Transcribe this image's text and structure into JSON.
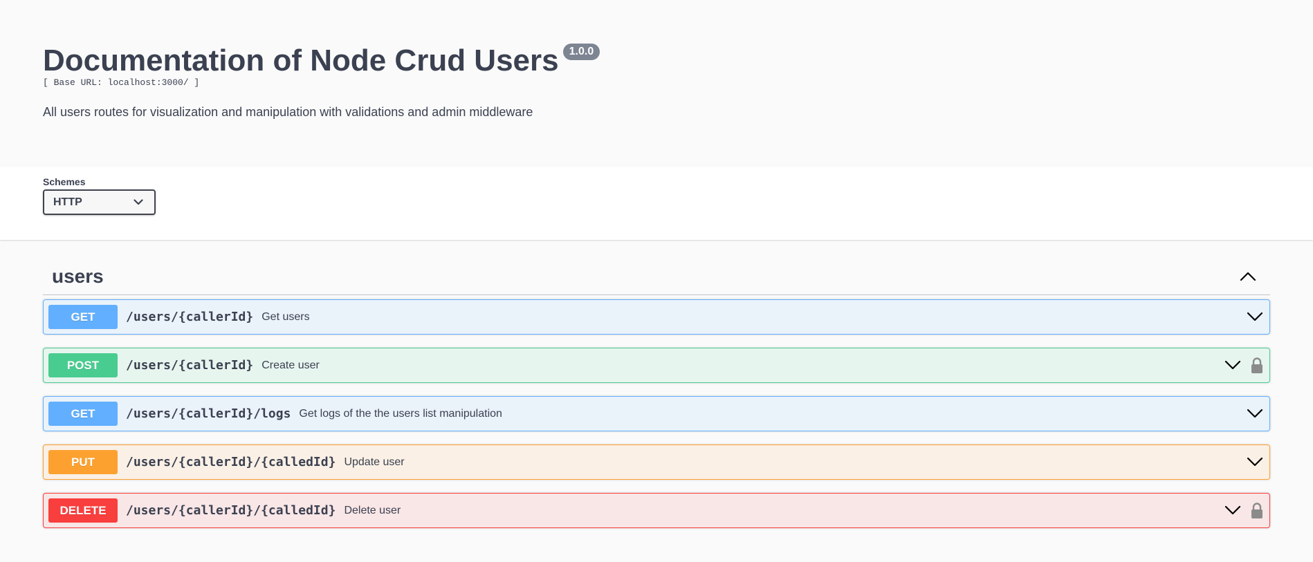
{
  "info": {
    "title": "Documentation of Node Crud Users",
    "version": "1.0.0",
    "base_url": "[ Base URL: localhost:3000/ ]",
    "description": "All users routes for visualization and manipulation with validations and admin middleware"
  },
  "schemes": {
    "label": "Schemes",
    "selected": "HTTP",
    "icon": "chevron-down-icon"
  },
  "tag": {
    "name": "users",
    "icon": "chevron-up-icon"
  },
  "operations": [
    {
      "method": "GET",
      "path": "/users/{callerId}",
      "summary": "Get users",
      "locked": false
    },
    {
      "method": "POST",
      "path": "/users/{callerId}",
      "summary": "Create user",
      "locked": true
    },
    {
      "method": "GET",
      "path": "/users/{callerId}/logs",
      "summary": "Get logs of the the users list manipulation",
      "locked": false
    },
    {
      "method": "PUT",
      "path": "/users/{callerId}/{calledId}",
      "summary": "Update user",
      "locked": false
    },
    {
      "method": "DELETE",
      "path": "/users/{callerId}/{calledId}",
      "summary": "Delete user",
      "locked": true
    }
  ],
  "colors": {
    "get": "#61affe",
    "post": "#49cc90",
    "put": "#fca130",
    "delete": "#f93e3e",
    "text": "#3b4151"
  }
}
